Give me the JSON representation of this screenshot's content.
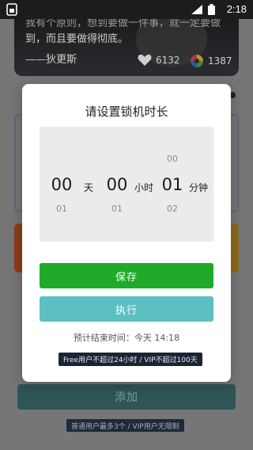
{
  "status_bar": {
    "time": "2:18",
    "icons": [
      "app-icon",
      "wifi-signal-icon",
      "battery-icon"
    ]
  },
  "background": {
    "quote": {
      "line1": "我有个原则，想到要做一件事，就一定要做",
      "line2": "到，而且要做得彻底。",
      "author": "——狄更斯"
    },
    "likes": "6132",
    "views": "1387",
    "add_button": "添加",
    "add_note": "普通用户最多3个 / VIP用户无限制"
  },
  "dialog": {
    "title": "请设置锁机时长",
    "picker": {
      "days": {
        "above": "",
        "selected": "00",
        "below": "01"
      },
      "hours": {
        "above": "",
        "selected": "00",
        "below": "01"
      },
      "minutes": {
        "above": "00",
        "selected": "01",
        "below": "02"
      },
      "unit_day": "天",
      "unit_hour": "小时",
      "unit_minute": "分钟"
    },
    "save_label": "保存",
    "exec_label": "执行",
    "end_time": "预计结束时间：今天 14:18",
    "limit_note": "Free用户不超过24小时 / VIP不超过100天"
  },
  "colors": {
    "save": "#1faa2a",
    "exec": "#5cc0c2",
    "picker_bg": "#ebebeb",
    "overlay": "#767676"
  }
}
